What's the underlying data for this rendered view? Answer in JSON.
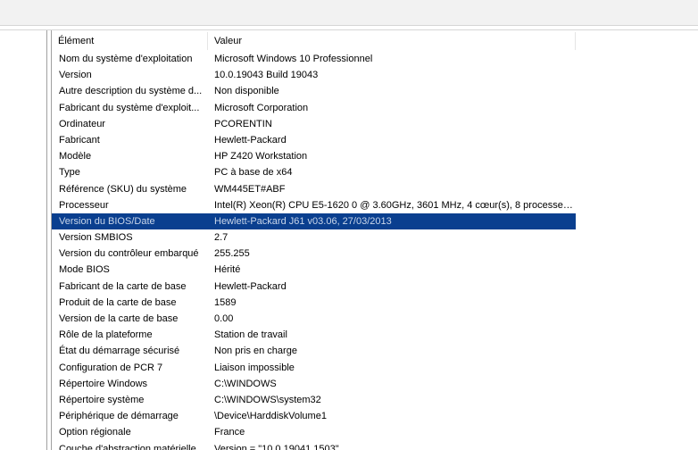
{
  "table": {
    "headers": {
      "element": "Élément",
      "value": "Valeur"
    },
    "selected_index": 10,
    "rows": [
      {
        "element": "Nom du système d'exploitation",
        "value": "Microsoft Windows 10 Professionnel"
      },
      {
        "element": "Version",
        "value": "10.0.19043 Build 19043"
      },
      {
        "element": "Autre description du système d...",
        "value": "Non disponible"
      },
      {
        "element": "Fabricant du système d'exploit...",
        "value": "Microsoft Corporation"
      },
      {
        "element": "Ordinateur",
        "value": "PCORENTIN"
      },
      {
        "element": "Fabricant",
        "value": "Hewlett-Packard"
      },
      {
        "element": "Modèle",
        "value": "HP Z420 Workstation"
      },
      {
        "element": "Type",
        "value": "PC à base de x64"
      },
      {
        "element": "Référence (SKU) du système",
        "value": "WM445ET#ABF"
      },
      {
        "element": "Processeur",
        "value": "Intel(R) Xeon(R) CPU E5-1620 0 @ 3.60GHz, 3601 MHz, 4 cœur(s), 8 processeu..."
      },
      {
        "element": "Version du BIOS/Date",
        "value": "Hewlett-Packard J61 v03.06, 27/03/2013"
      },
      {
        "element": "Version SMBIOS",
        "value": "2.7"
      },
      {
        "element": "Version du contrôleur embarqué",
        "value": "255.255"
      },
      {
        "element": "Mode BIOS",
        "value": "Hérité"
      },
      {
        "element": "Fabricant de la carte de base",
        "value": "Hewlett-Packard"
      },
      {
        "element": "Produit de la carte de base",
        "value": "1589"
      },
      {
        "element": "Version de la carte de base",
        "value": "0.00"
      },
      {
        "element": "Rôle de la plateforme",
        "value": "Station de travail"
      },
      {
        "element": "État du démarrage sécurisé",
        "value": "Non pris en charge"
      },
      {
        "element": "Configuration de PCR 7",
        "value": "Liaison impossible"
      },
      {
        "element": "Répertoire Windows",
        "value": "C:\\WINDOWS"
      },
      {
        "element": "Répertoire système",
        "value": "C:\\WINDOWS\\system32"
      },
      {
        "element": "Périphérique de démarrage",
        "value": "\\Device\\HarddiskVolume1"
      },
      {
        "element": "Option régionale",
        "value": "France"
      },
      {
        "element": "Couche d'abstraction matérielle",
        "value": "Version = \"10.0.19041.1503\""
      }
    ]
  },
  "colors": {
    "selection_bg": "#0a3f8f",
    "selection_text": "#c9d6ea"
  }
}
